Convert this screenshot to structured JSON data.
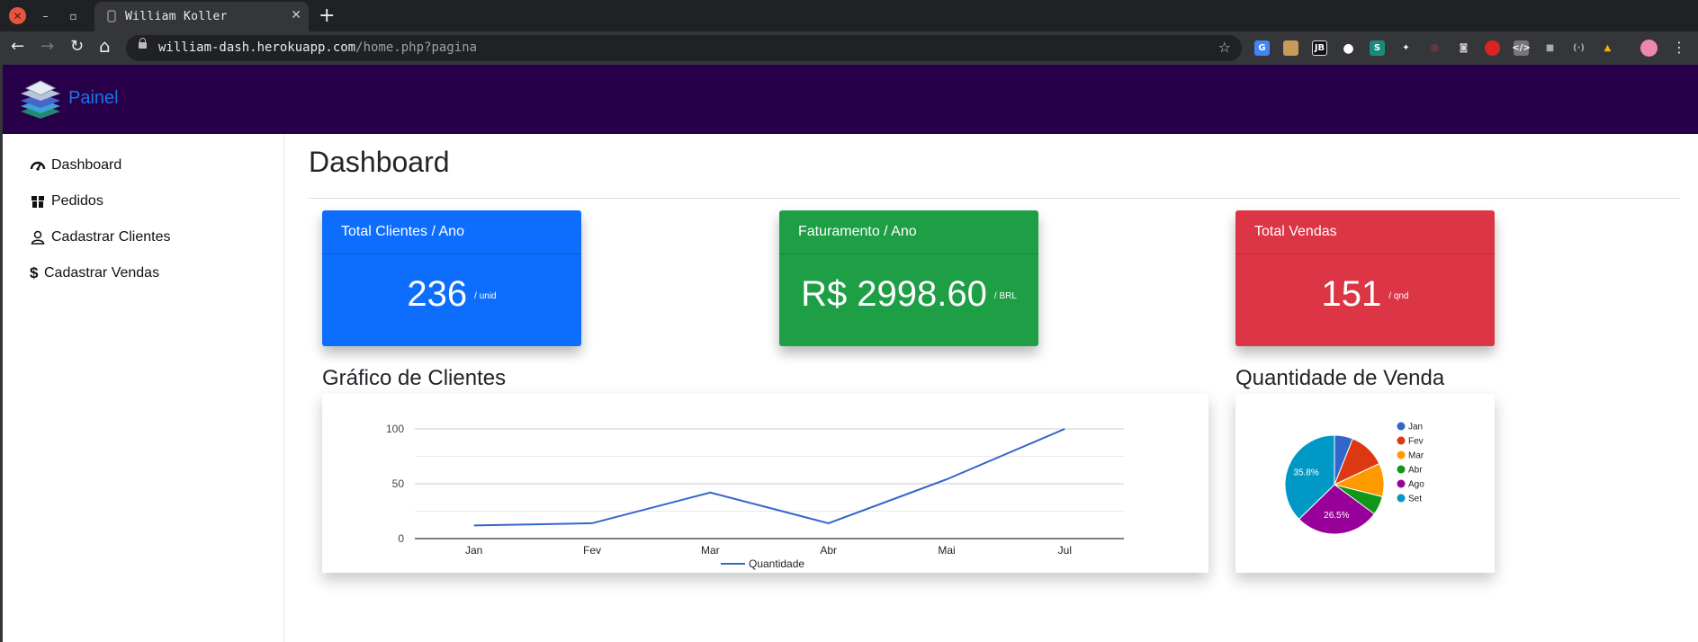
{
  "browser": {
    "tab_title": "William Koller",
    "url_host": "william-dash.herokuapp.com",
    "url_path": "/home.php?pagina"
  },
  "app": {
    "brand": "Painel",
    "page_title": "Dashboard"
  },
  "sidebar": {
    "items": [
      {
        "label": "Dashboard",
        "icon": "speedometer-icon"
      },
      {
        "label": "Pedidos",
        "icon": "box-icon"
      },
      {
        "label": "Cadastrar Clientes",
        "icon": "user-icon"
      },
      {
        "label": "Cadastrar Vendas",
        "icon": "dollar-icon"
      }
    ]
  },
  "cards": [
    {
      "title": "Total Clientes / Ano",
      "value": "236",
      "unit": "/ unid",
      "color": "#0d6efd"
    },
    {
      "title": "Faturamento / Ano",
      "value": "R$ 2998.60",
      "unit": "/ BRL",
      "color": "#1e9e45"
    },
    {
      "title": "Total Vendas",
      "value": "151",
      "unit": "/ qnd",
      "color": "#dc3545"
    }
  ],
  "sections": {
    "line_title": "Gráfico de Clientes",
    "pie_title": "Quantidade de Venda"
  },
  "chart_data": [
    {
      "type": "line",
      "categories": [
        "Jan",
        "Fev",
        "Mar",
        "Abr",
        "Mai",
        "Jul"
      ],
      "series": [
        {
          "name": "Quantidade",
          "values": [
            12,
            14,
            42,
            14,
            54,
            100
          ],
          "color": "#3366cc"
        }
      ],
      "yticks": [
        0,
        50,
        100
      ],
      "ylim": [
        0,
        100
      ],
      "grid": true,
      "legend": "bottom"
    },
    {
      "type": "pie",
      "categories": [
        "Jan",
        "Fev",
        "Mar",
        "Abr",
        "Ago",
        "Set"
      ],
      "values": [
        5.8,
        11.5,
        10.5,
        5.9,
        26.5,
        35.8
      ],
      "colors": [
        "#3366cc",
        "#dc3912",
        "#ff9900",
        "#109618",
        "#990099",
        "#0099c6"
      ],
      "slice_labels": [
        "",
        "",
        "",
        "",
        "26.5%",
        "35.8%"
      ],
      "legend": "right"
    }
  ]
}
